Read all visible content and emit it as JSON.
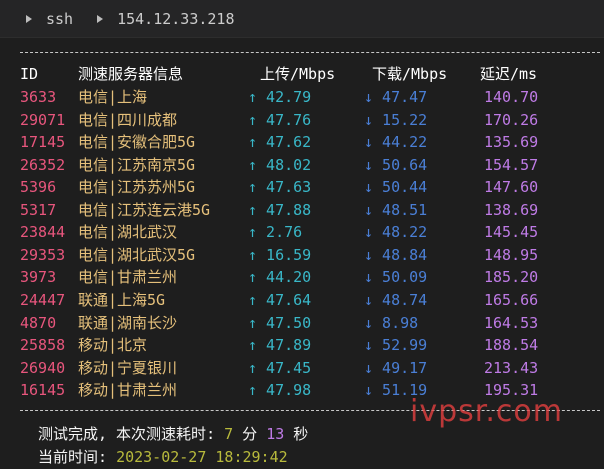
{
  "titlebar": {
    "shell": "ssh",
    "host": "154.12.33.218"
  },
  "table": {
    "headers": {
      "id": "ID",
      "server": "测速服务器信息",
      "upload": "上传/Mbps",
      "download": "下载/Mbps",
      "latency": "延迟/ms"
    },
    "rows": [
      {
        "id": "3633",
        "server": "电信|上海",
        "up": "↑ 42.79",
        "down": "↓ 47.47",
        "lat": "140.70"
      },
      {
        "id": "29071",
        "server": "电信|四川成都",
        "up": "↑ 47.76",
        "down": "↓ 15.22",
        "lat": "170.26"
      },
      {
        "id": "17145",
        "server": "电信|安徽合肥5G",
        "up": "↑ 47.62",
        "down": "↓ 44.22",
        "lat": "135.69"
      },
      {
        "id": "26352",
        "server": "电信|江苏南京5G",
        "up": "↑ 48.02",
        "down": "↓ 50.64",
        "lat": "154.57"
      },
      {
        "id": "5396",
        "server": "电信|江苏苏州5G",
        "up": "↑ 47.63",
        "down": "↓ 50.44",
        "lat": "147.60"
      },
      {
        "id": "5317",
        "server": "电信|江苏连云港5G",
        "up": "↑ 47.88",
        "down": "↓ 48.51",
        "lat": "138.69"
      },
      {
        "id": "23844",
        "server": "电信|湖北武汉",
        "up": "↑ 2.76",
        "down": "↓ 48.22",
        "lat": "145.45"
      },
      {
        "id": "29353",
        "server": "电信|湖北武汉5G",
        "up": "↑ 16.59",
        "down": "↓ 48.84",
        "lat": "148.95"
      },
      {
        "id": "3973",
        "server": "电信|甘肃兰州",
        "up": "↑ 44.20",
        "down": "↓ 50.09",
        "lat": "185.20"
      },
      {
        "id": "24447",
        "server": "联通|上海5G",
        "up": "↑ 47.64",
        "down": "↓ 48.74",
        "lat": "165.66"
      },
      {
        "id": "4870",
        "server": "联通|湖南长沙",
        "up": "↑ 47.50",
        "down": "↓ 8.98",
        "lat": "164.53"
      },
      {
        "id": "25858",
        "server": "移动|北京",
        "up": "↑ 47.89",
        "down": "↓ 52.99",
        "lat": "188.54"
      },
      {
        "id": "26940",
        "server": "移动|宁夏银川",
        "up": "↑ 47.45",
        "down": "↓ 49.17",
        "lat": "213.43"
      },
      {
        "id": "16145",
        "server": "移动|甘肃兰州",
        "up": "↑ 47.98",
        "down": "↓ 51.19",
        "lat": "195.31"
      }
    ]
  },
  "footer": {
    "done_prefix": "测试完成, 本次测速耗时: ",
    "minutes": "7",
    "min_unit": " 分 ",
    "seconds": "13",
    "sec_unit": " 秒",
    "time_prefix": "当前时间: ",
    "time_value": "2023-02-27 18:29:42"
  },
  "watermark": "ivpsr.com"
}
